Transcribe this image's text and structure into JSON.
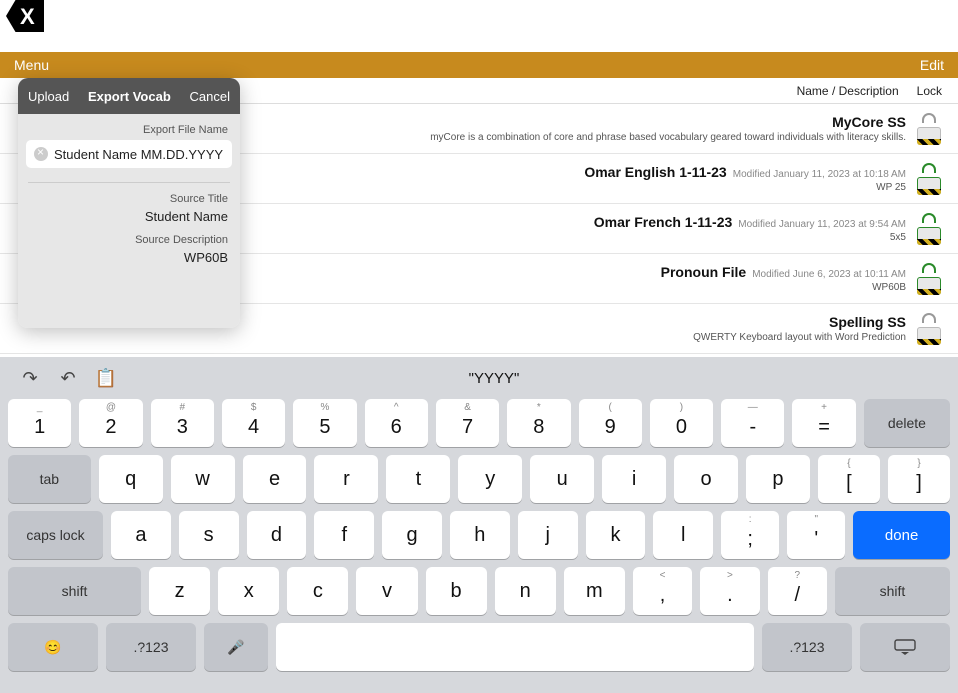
{
  "logo_letter": "X",
  "topbar": {
    "menu": "Menu",
    "edit": "Edit"
  },
  "header": {
    "lock": "Lock",
    "name": "Name / Description"
  },
  "files": [
    {
      "title": "MyCore SS",
      "mod": "",
      "sub": "myCore is a combination of core and phrase based vocabulary geared toward individuals with literacy skills.",
      "lock": "plain"
    },
    {
      "title": "Omar English 1-11-23",
      "mod": "Modified January 11, 2023 at 10:18 AM",
      "sub": "WP 25",
      "lock": "green"
    },
    {
      "title": "Omar French 1-11-23",
      "mod": "Modified January 11, 2023 at 9:54 AM",
      "sub": "5x5",
      "lock": "green"
    },
    {
      "title": "Pronoun File",
      "mod": "Modified June 6, 2023 at 10:11 AM",
      "sub": "WP60B",
      "lock": "green"
    },
    {
      "title": "Spelling SS",
      "mod": "",
      "sub": "QWERTY Keyboard layout with Word Prediction",
      "lock": "plain"
    }
  ],
  "popover": {
    "upload": "Upload",
    "title": "Export Vocab",
    "cancel": "Cancel",
    "label_file": "Export File Name",
    "input_value": "Student Name MM.DD.YYYY",
    "label_src_title": "Source Title",
    "val_src_title": "Student Name",
    "label_src_desc": "Source Description",
    "val_src_desc": "WP60B"
  },
  "keyboard": {
    "suggestion": "\"YYYY\"",
    "row1": [
      {
        "p": "1",
        "s": "_"
      },
      {
        "p": "2",
        "s": "@"
      },
      {
        "p": "3",
        "s": "#"
      },
      {
        "p": "4",
        "s": "$"
      },
      {
        "p": "5",
        "s": "%"
      },
      {
        "p": "6",
        "s": "^"
      },
      {
        "p": "7",
        "s": "&"
      },
      {
        "p": "8",
        "s": "*"
      },
      {
        "p": "9",
        "s": "("
      },
      {
        "p": "0",
        "s": ")"
      },
      {
        "p": "-",
        "s": "—"
      },
      {
        "p": "=",
        "s": "+"
      }
    ],
    "delete": "delete",
    "tab": "tab",
    "row2": [
      "q",
      "w",
      "e",
      "r",
      "t",
      "y",
      "u",
      "i",
      "o",
      "p"
    ],
    "row2b": [
      {
        "p": "[",
        "s": "{"
      },
      {
        "p": "]",
        "s": "}"
      }
    ],
    "caps": "caps lock",
    "row3": [
      "a",
      "s",
      "d",
      "f",
      "g",
      "h",
      "j",
      "k",
      "l"
    ],
    "row3b": [
      {
        "p": ";",
        "s": ":"
      },
      {
        "p": "'",
        "s": "\""
      }
    ],
    "done": "done",
    "shift": "shift",
    "row4": [
      "z",
      "x",
      "c",
      "v",
      "b",
      "n",
      "m"
    ],
    "row4b": [
      {
        "p": ",",
        "s": "<"
      },
      {
        "p": ".",
        "s": ">"
      },
      {
        "p": "/",
        "s": "?"
      }
    ],
    "numkey": ".?123"
  }
}
